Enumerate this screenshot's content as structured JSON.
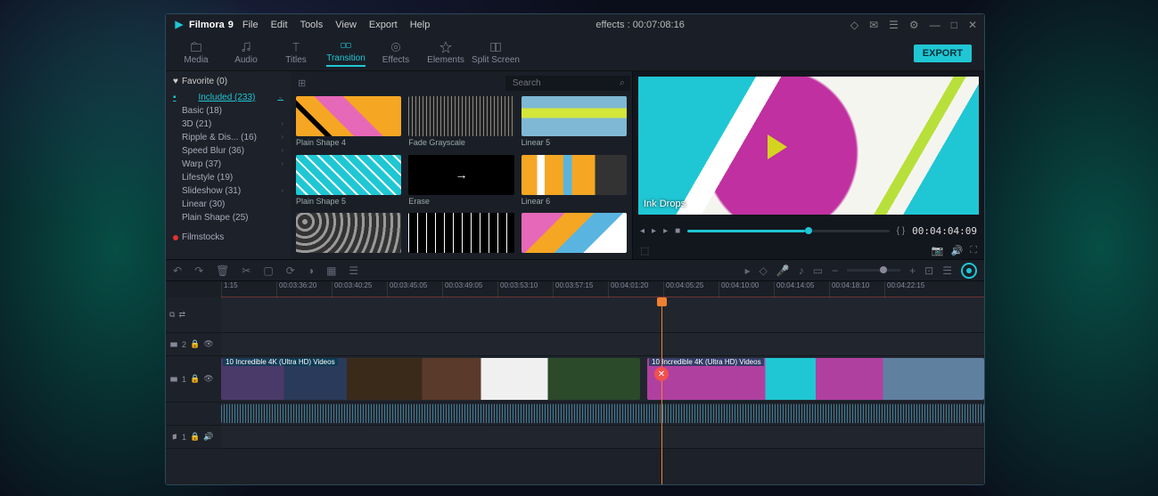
{
  "app": {
    "name": "Filmora",
    "version": "9"
  },
  "menubar": [
    "File",
    "Edit",
    "Tools",
    "View",
    "Export",
    "Help"
  ],
  "windowTitle": "effects : 00:07:08:16",
  "toolTabs": [
    {
      "label": "Media",
      "icon": "folder"
    },
    {
      "label": "Audio",
      "icon": "music"
    },
    {
      "label": "Titles",
      "icon": "text"
    },
    {
      "label": "Transition",
      "icon": "transition",
      "active": true
    },
    {
      "label": "Effects",
      "icon": "fx"
    },
    {
      "label": "Elements",
      "icon": "star"
    },
    {
      "label": "Split Screen",
      "icon": "split"
    }
  ],
  "exportLabel": "EXPORT",
  "sidebar": {
    "favorite": "Favorite (0)",
    "categories": [
      {
        "label": "Included (233)",
        "sel": true
      },
      {
        "label": "Basic (18)"
      },
      {
        "label": "3D (21)",
        "sub": true
      },
      {
        "label": "Ripple & Dis... (16)",
        "sub": true
      },
      {
        "label": "Speed Blur (36)",
        "sub": true
      },
      {
        "label": "Warp (37)",
        "sub": true
      },
      {
        "label": "Lifestyle (19)"
      },
      {
        "label": "Slideshow (31)",
        "sub": true
      },
      {
        "label": "Linear (30)"
      },
      {
        "label": "Plain Shape (25)"
      }
    ],
    "filmstocks": "Filmstocks"
  },
  "searchPlaceholder": "Search",
  "thumbnails": [
    {
      "label": "Plain Shape 4"
    },
    {
      "label": "Fade Grayscale"
    },
    {
      "label": "Linear 5"
    },
    {
      "label": "Plain Shape 5"
    },
    {
      "label": "Erase"
    },
    {
      "label": "Linear 6"
    }
  ],
  "preview": {
    "overlayText": "Ink Drops",
    "markers": "{  }",
    "timecode": "00:04:04:09"
  },
  "ruler": [
    "1:15",
    "00:03:36:20",
    "00:03:40:25",
    "00:03:45:05",
    "00:03:49:05",
    "00:03:53:10",
    "00:03:57:15",
    "00:04:01:20",
    "00:04:05:25",
    "00:04:10:00",
    "00:04:14:05",
    "00:04:18:10",
    "00:04:22:15"
  ],
  "tracks": {
    "video2": "2",
    "video1": "1",
    "audio1": "1",
    "clipLabel1": "10 Incredible 4K (Ultra HD) Videos",
    "clipLabel2": "10 Incredible 4K (Ultra HD) Videos"
  }
}
